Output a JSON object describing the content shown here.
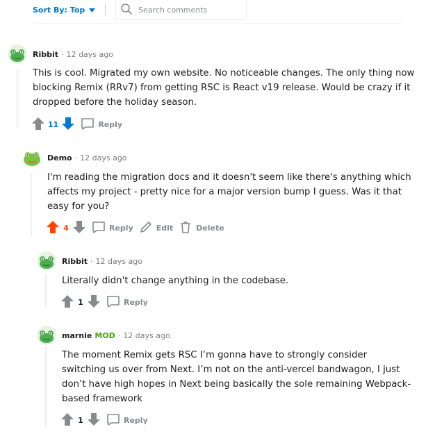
{
  "toolbar": {
    "sort_label": "Sort By: Top",
    "search_placeholder": "Search comments"
  },
  "colors": {
    "accent": "#0079d3",
    "upvoted": "#ff4500",
    "mod": "#46a508",
    "muted": "#878a8c"
  },
  "comments": [
    {
      "author": "Ribbit",
      "time": "12 days ago",
      "body": "This is cool. Migrated my own website. No noticeable changes. The only thing now blocking Remix (RRv7) from getting RSC is React v19 release. Would be crazy if it dropped before the holiday season.",
      "votes": "11",
      "reply": "Reply"
    },
    {
      "author": "Demo",
      "time": "12 days ago",
      "body": "I'm reading the migration docs and it doesn't seem like there's anything which affects my project - pretty nice for a major version bump I guess. Was it that easy for you?",
      "votes": "4",
      "reply": "Reply",
      "edit": "Edit",
      "delete": "Delete"
    },
    {
      "author": "Ribbit",
      "time": "12 days ago",
      "body": "Literally didn't change anything in the codebase.",
      "votes": "1",
      "reply": "Reply"
    },
    {
      "author": "marnie",
      "badge": "MOD",
      "time": "12 days ago",
      "body": "The moment Remix gets RSC I’m gonna have to strongly consider switching us over from Next. I’m not on the anti-vercel bandwagon, I just don’t have high hopes in Next being basically the sole remaining Webpack-based framework",
      "votes": "1",
      "reply": "Reply"
    }
  ]
}
